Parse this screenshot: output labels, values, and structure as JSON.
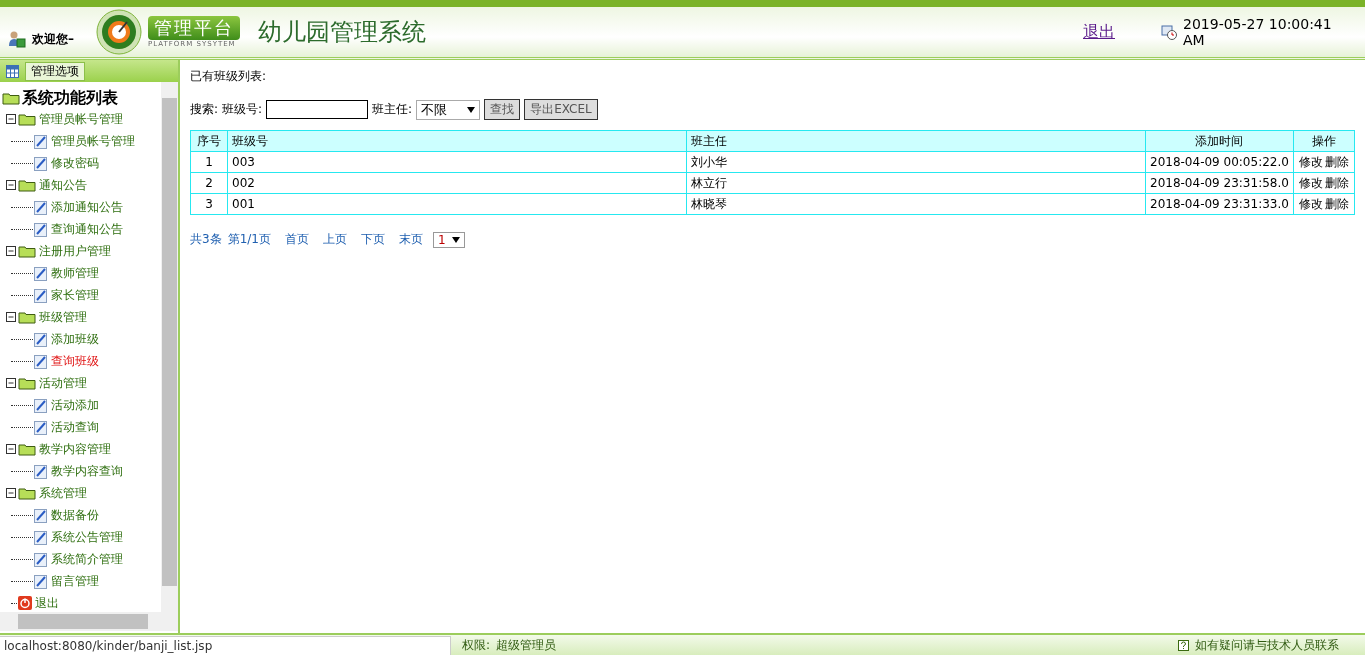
{
  "header": {
    "welcome": "欢迎您–",
    "logo_badge": "管理平台",
    "logo_sub": "PLATFORM SYSYTEM",
    "title": "幼儿园管理系统",
    "logout": "退出",
    "datetime": "2019-05-27 10:00:41 AM"
  },
  "sidebar": {
    "tab": "管理选项",
    "tree": {
      "label": "系统功能列表",
      "children": [
        {
          "kind": "group",
          "label": "管理员帐号管理",
          "children": [
            {
              "label": "管理员帐号管理",
              "selected": false
            },
            {
              "label": "修改密码",
              "selected": false
            }
          ]
        },
        {
          "kind": "group",
          "label": "通知公告",
          "children": [
            {
              "label": "添加通知公告",
              "selected": false
            },
            {
              "label": "查询通知公告",
              "selected": false
            }
          ]
        },
        {
          "kind": "group",
          "label": "注册用户管理",
          "children": [
            {
              "label": "教师管理",
              "selected": false
            },
            {
              "label": "家长管理",
              "selected": false
            }
          ]
        },
        {
          "kind": "group",
          "label": "班级管理",
          "children": [
            {
              "label": "添加班级",
              "selected": false
            },
            {
              "label": "查询班级",
              "selected": true
            }
          ]
        },
        {
          "kind": "group",
          "label": "活动管理",
          "children": [
            {
              "label": "活动添加",
              "selected": false
            },
            {
              "label": "活动查询",
              "selected": false
            }
          ]
        },
        {
          "kind": "group",
          "label": "教学内容管理",
          "children": [
            {
              "label": "教学内容查询",
              "selected": false
            }
          ]
        },
        {
          "kind": "group",
          "label": "系统管理",
          "children": [
            {
              "label": "数据备份",
              "selected": false
            },
            {
              "label": "系统公告管理",
              "selected": false
            },
            {
              "label": "系统简介管理",
              "selected": false
            },
            {
              "label": "留言管理",
              "selected": false
            }
          ]
        },
        {
          "kind": "exit",
          "label": "退出"
        }
      ]
    }
  },
  "main": {
    "heading": "已有班级列表:",
    "search": {
      "label": "搜索:",
      "class_label": "班级号:",
      "teacher_label": "班主任:",
      "teacher_value": "不限",
      "find_button": "查找",
      "export_button": "导出EXCEL"
    },
    "table": {
      "columns": [
        "序号",
        "班级号",
        "班主任",
        "添加时间",
        "操作"
      ],
      "rows": [
        {
          "no": "1",
          "class": "003",
          "teacher": "刘小华",
          "time": "2018-04-09 00:05:22.0",
          "actions": [
            "修改",
            "删除"
          ]
        },
        {
          "no": "2",
          "class": "002",
          "teacher": "林立行",
          "time": "2018-04-09 23:31:58.0",
          "actions": [
            "修改",
            "删除"
          ]
        },
        {
          "no": "3",
          "class": "001",
          "teacher": "林晓琴",
          "time": "2018-04-09 23:31:33.0",
          "actions": [
            "修改",
            "删除"
          ]
        }
      ]
    },
    "pagination": {
      "total": "共3条",
      "page": "第1/1页",
      "links": [
        "首页",
        "上页",
        "下页",
        "末页"
      ],
      "page_select": "1"
    }
  },
  "status_bar": {
    "role": "权限:",
    "role_value": "超级管理员",
    "help": "如有疑问请与技术人员联系"
  },
  "browser_status": "localhost:8080/kinder/banji_list.jsp"
}
